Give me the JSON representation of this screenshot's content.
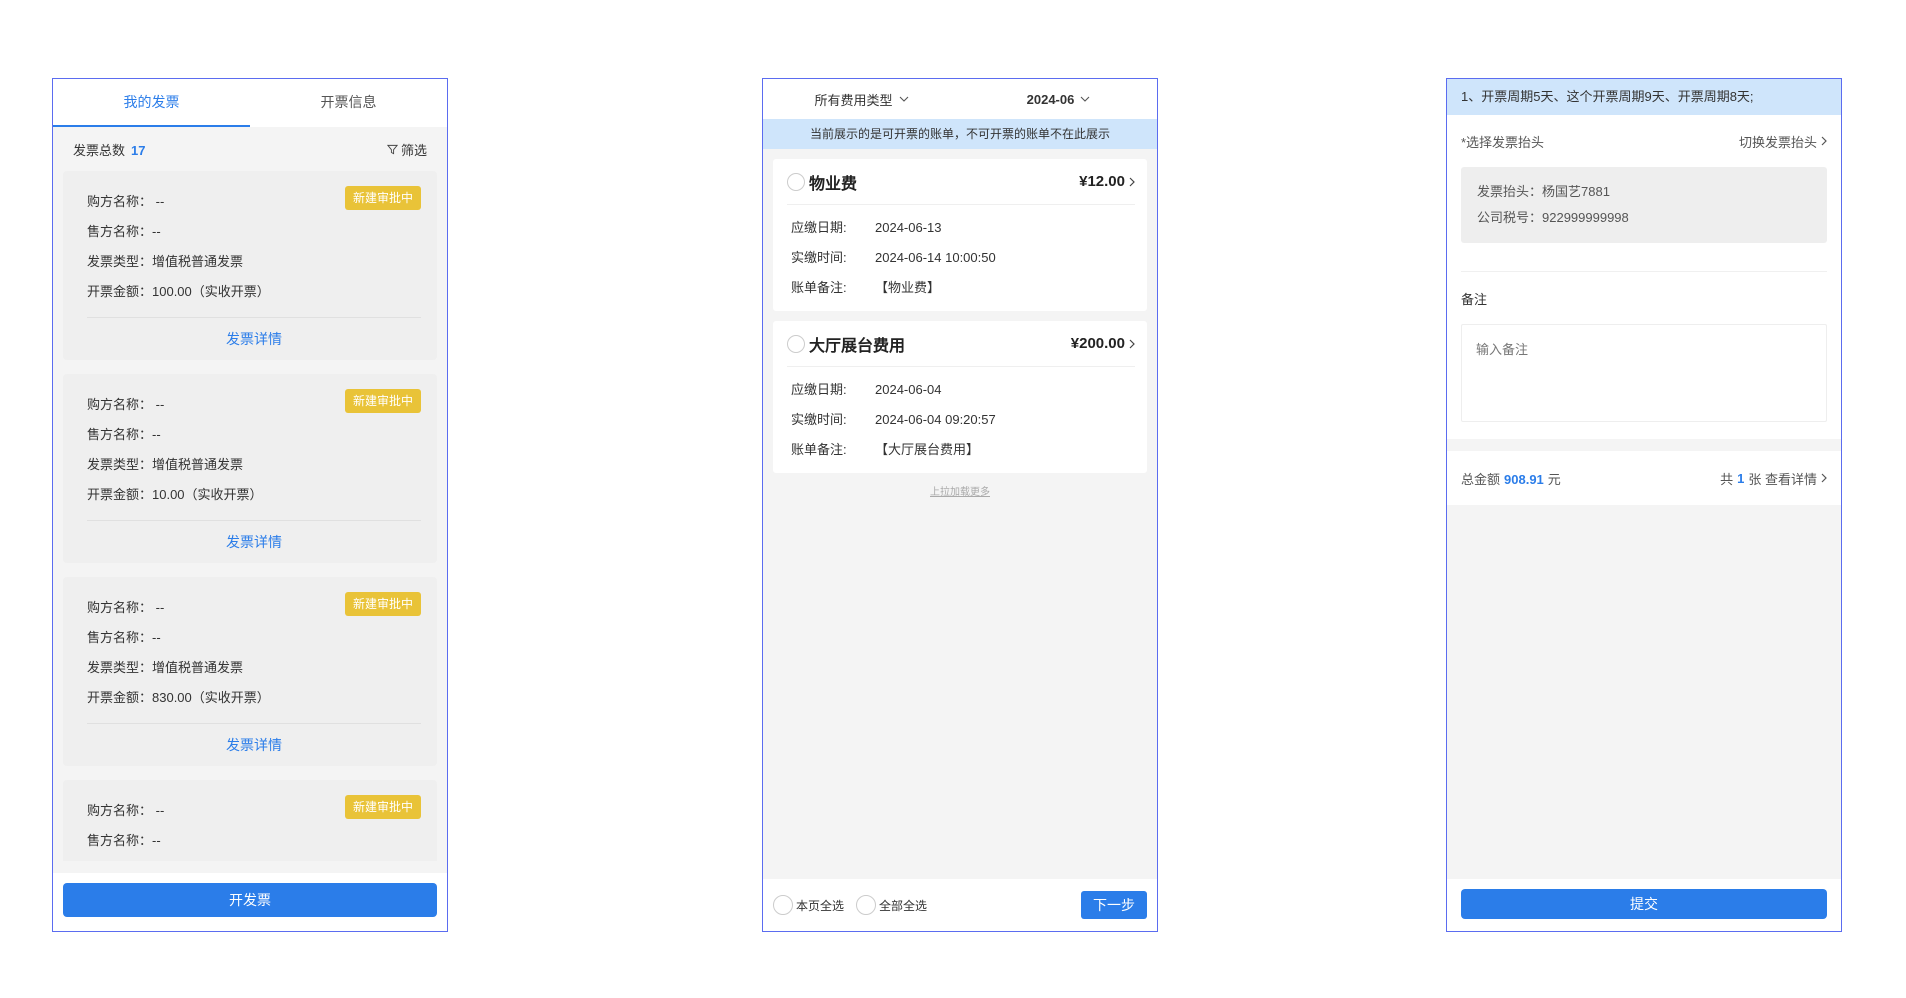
{
  "panel1": {
    "tabs": [
      {
        "label": "我的发票"
      },
      {
        "label": "开票信息"
      }
    ],
    "summary": {
      "label": "发票总数",
      "count": "17",
      "filter_label": "筛选"
    },
    "invoices": [
      {
        "buyer": "购方名称：  --",
        "seller": "售方名称：--",
        "type": "发票类型：增值税普通发票",
        "amount": "开票金额：100.00（实收开票）",
        "status": "新建审批中",
        "detail": "发票详情"
      },
      {
        "buyer": "购方名称：  --",
        "seller": "售方名称：--",
        "type": "发票类型：增值税普通发票",
        "amount": "开票金额：10.00（实收开票）",
        "status": "新建审批中",
        "detail": "发票详情"
      },
      {
        "buyer": "购方名称：  --",
        "seller": "售方名称：--",
        "type": "发票类型：增值税普通发票",
        "amount": "开票金额：830.00（实收开票）",
        "status": "新建审批中",
        "detail": "发票详情"
      },
      {
        "buyer": "购方名称：  --",
        "seller": "售方名称：--",
        "type": "发票类型：增值税普通发票",
        "status": "新建审批中"
      }
    ],
    "issue_button": "开发票"
  },
  "panel2": {
    "fee_type": "所有费用类型",
    "month": "2024-06",
    "notice": "当前展示的是可开票的账单，不可开票的账单不在此展示",
    "bills": [
      {
        "name": "物业费",
        "amount": "¥12.00",
        "due_label": "应缴日期:",
        "due": "2024-06-13",
        "paid_label": "实缴时间:",
        "paid": "2024-06-14 10:00:50",
        "remark_label": "账单备注:",
        "remark": "【物业费】"
      },
      {
        "name": "大厅展台费用",
        "amount": "¥200.00",
        "due_label": "应缴日期:",
        "due": "2024-06-04",
        "paid_label": "实缴时间:",
        "paid": "2024-06-04 09:20:57",
        "remark_label": "账单备注:",
        "remark": "【大厅展台费用】"
      }
    ],
    "load_more": "上拉加载更多",
    "select_page": "本页全选",
    "select_all": "全部全选",
    "next_button": "下一步"
  },
  "panel3": {
    "period_notice": "1、开票周期5天、这个开票周期9天、开票周期8天;",
    "choose_header_label": "*选择发票抬头",
    "switch_header": "切换发票抬头",
    "header_title": "发票抬头：杨国艺7881",
    "tax_no": "公司税号：922999999998",
    "memo_label": "备注",
    "memo_placeholder": "输入备注",
    "total_label": "总金额",
    "total_amount": "908.91",
    "total_unit": "元",
    "count_prefix": "共",
    "count": "1",
    "count_suffix": "张 查看详情",
    "submit_button": "提交"
  },
  "colors": {
    "accent": "#2b7de9",
    "badge": "#e9c338",
    "notice_bg": "#cfe5fb",
    "frame": "#5b6cf0"
  }
}
